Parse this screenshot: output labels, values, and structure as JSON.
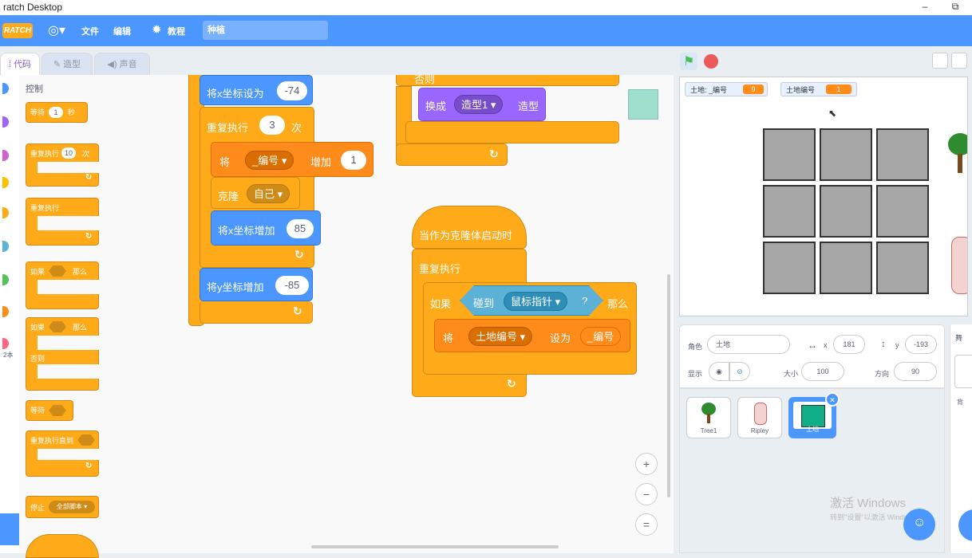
{
  "window": {
    "title": "ratch Desktop",
    "minimize": "–",
    "restore": "⧉"
  },
  "menubar": {
    "logo": "RATCH",
    "file": "文件",
    "edit": "编辑",
    "tutorials": "教程",
    "project_name": "种植"
  },
  "tabs": {
    "code": "代码",
    "costumes": "造型",
    "sounds": "声音"
  },
  "palette": {
    "category_label": "控制",
    "wait": "等待",
    "wait_value": "1",
    "wait_unit": "秒",
    "repeat": "重复执行",
    "repeat_value": "10",
    "repeat_unit": "次",
    "forever": "重复执行",
    "if_then": "如果",
    "then": "那么",
    "if_else": "如果",
    "else": "否则",
    "wait_until": "等待",
    "repeat_until": "重复执行直到",
    "stop": "停止",
    "stop_option": "全部脚本 ▾"
  },
  "categories": [
    {
      "color": "#4c97ff"
    },
    {
      "color": "#9966ff"
    },
    {
      "color": "#cf63cf"
    },
    {
      "color": "#ffbf00"
    },
    {
      "color": "#ffab19"
    },
    {
      "color": "#5cb1d6"
    },
    {
      "color": "#59c059"
    },
    {
      "color": "#ff8c1a"
    },
    {
      "color": "#ff6680"
    }
  ],
  "cat_side_label": "2本",
  "script1": {
    "setx": "将x坐标设为",
    "setx_value": "-74",
    "repeat": "重复执行",
    "repeat_value": "3",
    "repeat_unit": "次",
    "change_label": "将",
    "change_var": "_编号 ▾",
    "change_verb": "增加",
    "change_value": "1",
    "clone": "克隆",
    "clone_target": "自己 ▾",
    "changex": "将x坐标增加",
    "changex_value": "85",
    "changey": "将y坐标增加",
    "changey_value": "-85"
  },
  "script2": {
    "partial_top": "否则",
    "switch": "换成",
    "switch_costume": "造型1 ▾",
    "switch_tail": "造型"
  },
  "script3": {
    "hat": "当作为克隆体启动时",
    "forever": "重复执行",
    "if": "如果",
    "touching": "碰到",
    "touching_target": "鼠标指针 ▾",
    "q": "?",
    "then": "那么",
    "set_label": "将",
    "set_var": "土地编号 ▾",
    "set_verb": "设为",
    "set_value": "_编号"
  },
  "zoom": {
    "in": "+",
    "out": "−",
    "reset": "="
  },
  "stage": {
    "monitor1_label": "土地: _编号",
    "monitor1_value": "9",
    "monitor2_label": "土地编号",
    "monitor2_value": "1"
  },
  "sprite_info": {
    "sprite_label": "角色",
    "sprite_name": "土地",
    "x_label": "x",
    "x_value": "181",
    "y_label": "y",
    "y_value": "-193",
    "show_label": "显示",
    "size_label": "大小",
    "size_value": "100",
    "direction_label": "方向",
    "direction_value": "90"
  },
  "sprites": [
    {
      "name": "Tree1"
    },
    {
      "name": "Ripley"
    },
    {
      "name": "土地"
    }
  ],
  "watermark": {
    "line1": "激活 Windows",
    "line2": "转到\"设置\"以激活 Windows。"
  },
  "stage_panel": {
    "letter": "舞",
    "hint": "背"
  }
}
